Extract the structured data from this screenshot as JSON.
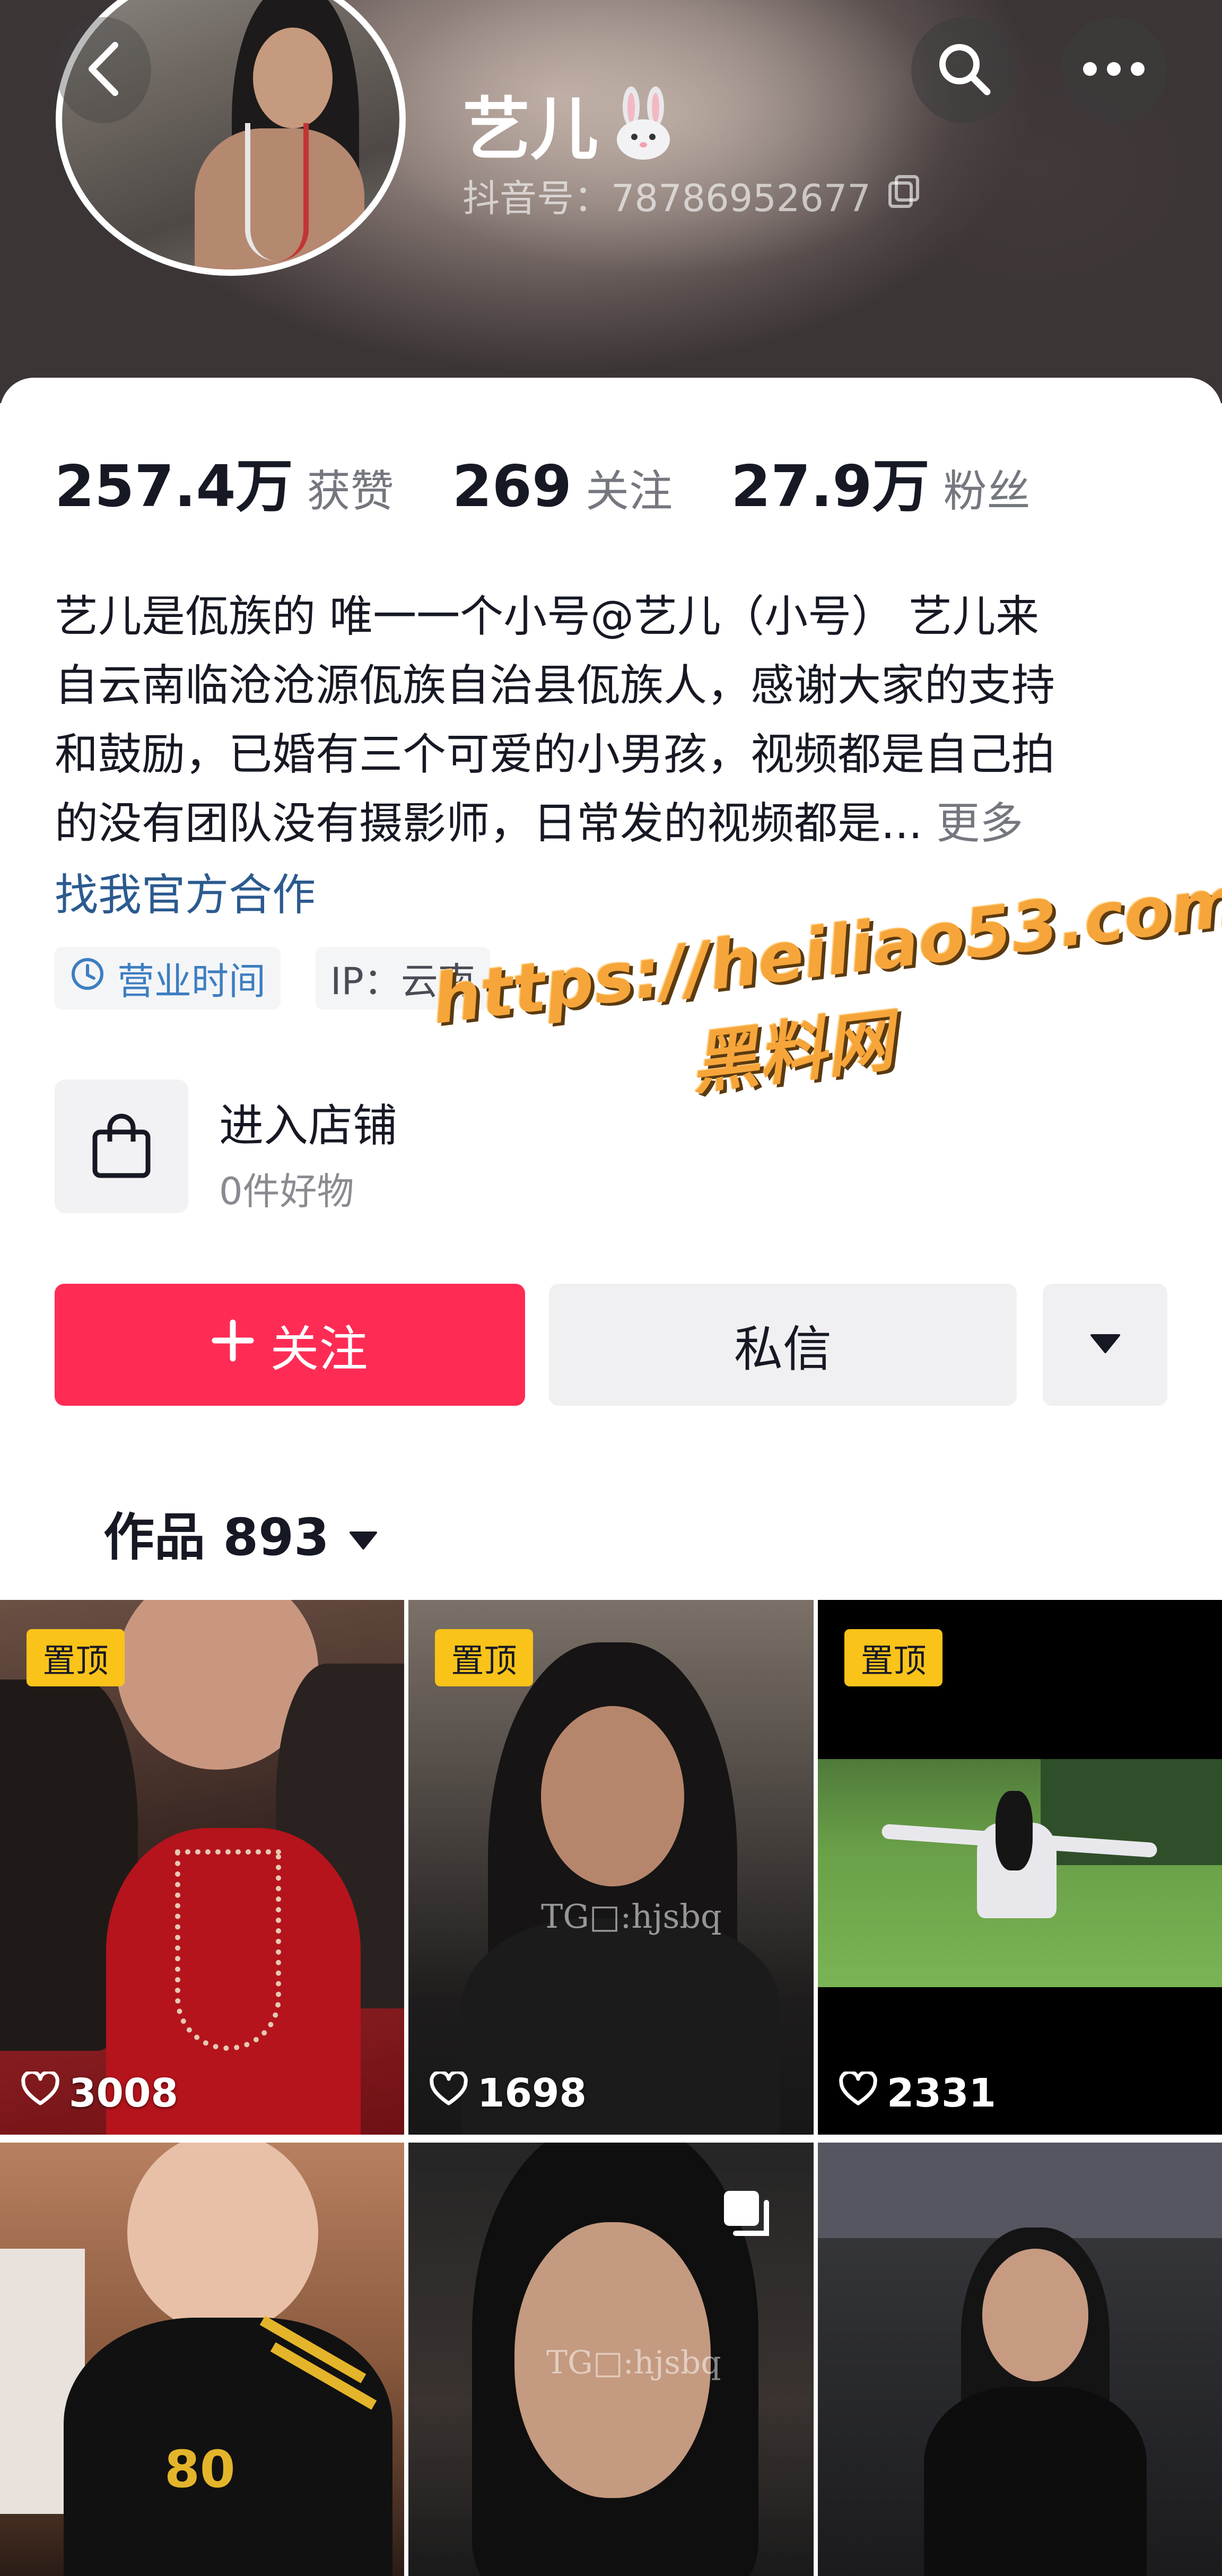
{
  "profile": {
    "nickname": "艺儿",
    "douyin_id": "抖音号：78786952677"
  },
  "stats": {
    "likes_value": "257.4万",
    "likes_label": "获赞",
    "following_value": "269",
    "following_label": "关注",
    "followers_value": "27.9万",
    "followers_label": "粉丝"
  },
  "bio": {
    "lines": [
      "艺儿是佤族的  唯一一个小号@艺儿（小号）   艺儿来",
      "自云南临沧沧源佤族自治县佤族人，感谢大家的支持",
      "和鼓励，已婚有三个可爱的小男孩，视频都是自己拍",
      "的没有团队没有摄影师，日常发的视频都是..."
    ],
    "more_label": "更多",
    "link_label": "找我官方合作"
  },
  "tags": {
    "business_hours": "营业时间",
    "ip": "IP：云南"
  },
  "shop": {
    "title": "进入店铺",
    "subtitle": "0件好物"
  },
  "watermark": {
    "url": "https://heiliao53.com",
    "name": "黑料网"
  },
  "actions": {
    "follow_label": "关注",
    "message_label": "私信"
  },
  "works": {
    "tab_label": "作品 893"
  },
  "videos": [
    {
      "pinned": true,
      "pin_label": "置顶",
      "likes": "3008"
    },
    {
      "pinned": true,
      "pin_label": "置顶",
      "likes": "1698",
      "overlay_text": "TG□:hjsbq"
    },
    {
      "pinned": true,
      "pin_label": "置顶",
      "likes": "2331"
    },
    {
      "pinned": false,
      "overlay_text": "80"
    },
    {
      "pinned": false,
      "overlay_text": "TG□:hjsbq",
      "multi_image": true
    },
    {
      "pinned": false
    }
  ],
  "colors": {
    "accent_red": "#fe2c55",
    "pin_yellow": "#f9c31a",
    "link_blue": "#2b5a8f",
    "watermark_orange": "#f6a53a"
  },
  "icons": {
    "back": "chevron-left-icon",
    "search": "search-icon",
    "more": "more-dots-icon",
    "copy": "copy-icon",
    "clock": "clock-icon",
    "shop": "shopping-bag-icon",
    "plus": "plus-icon",
    "dropdown": "triangle-down-icon",
    "heart": "heart-icon",
    "multi": "multi-image-icon"
  }
}
